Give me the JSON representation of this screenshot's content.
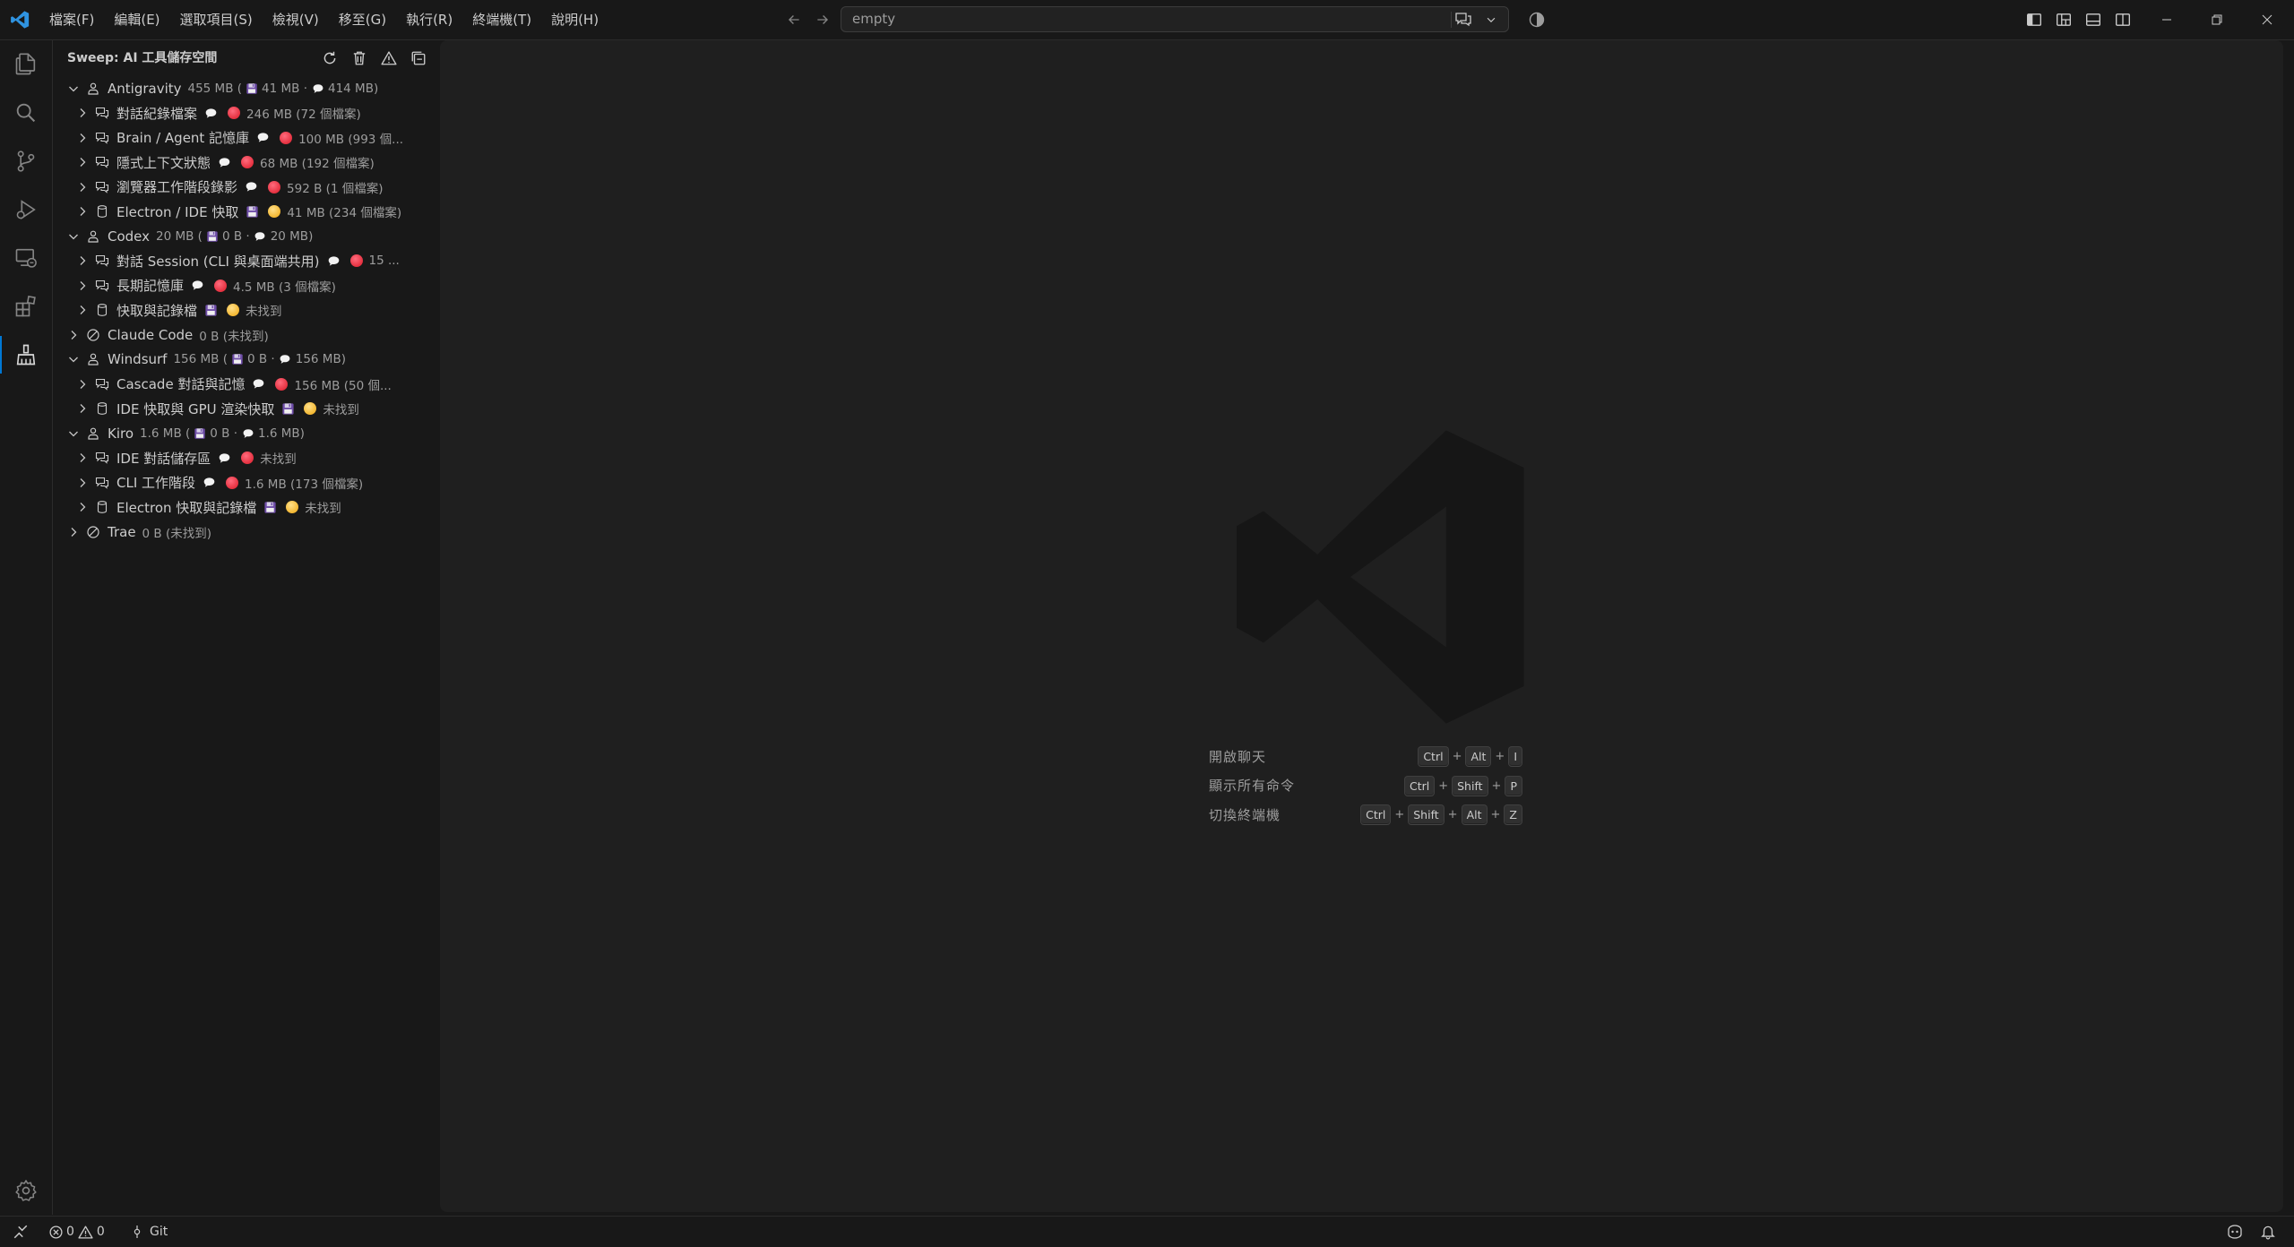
{
  "menubar": {
    "items": [
      "檔案(F)",
      "編輯(E)",
      "選取項目(S)",
      "檢視(V)",
      "移至(G)",
      "執行(R)",
      "終端機(T)",
      "說明(H)"
    ]
  },
  "command_center": {
    "text": "empty"
  },
  "sidebar": {
    "title": "Sweep: AI 工具儲存空間",
    "actions": [
      "refresh-icon",
      "trash-icon",
      "warning-icon",
      "collapse-all-icon"
    ],
    "tree": [
      {
        "kind": "group",
        "expanded": true,
        "label": "Antigravity",
        "size": "455 MB (",
        "mid": "41 MB ·",
        "end": "414 MB)",
        "children": [
          {
            "label": "對話紀錄檔案",
            "type": "chat",
            "status": "red",
            "desc": "246 MB (72 個檔案)"
          },
          {
            "label": "Brain / Agent 記憶庫",
            "type": "chat",
            "status": "red",
            "desc": "100 MB (993 個..."
          },
          {
            "label": "隱式上下文狀態",
            "type": "chat",
            "status": "red",
            "desc": "68 MB (192 個檔案)"
          },
          {
            "label": "瀏覽器工作階段錄影",
            "type": "chat",
            "status": "red",
            "desc": "592 B (1 個檔案)"
          },
          {
            "label": "Electron / IDE 快取",
            "type": "disk",
            "status": "yellow",
            "desc": "41 MB (234 個檔案)"
          }
        ]
      },
      {
        "kind": "group",
        "expanded": true,
        "label": "Codex",
        "size": "20 MB (",
        "mid": "0 B ·",
        "end": "20 MB)",
        "children": [
          {
            "label": "對話 Session (CLI 與桌面端共用)",
            "type": "chat",
            "status": "red",
            "desc": "15 ..."
          },
          {
            "label": "長期記憶庫",
            "type": "chat",
            "status": "red",
            "desc": "4.5 MB (3 個檔案)"
          },
          {
            "label": "快取與記錄檔",
            "type": "disk",
            "status": "yellow",
            "desc": "未找到"
          }
        ]
      },
      {
        "kind": "missing",
        "label": "Claude Code",
        "desc": "0 B (未找到)"
      },
      {
        "kind": "group",
        "expanded": true,
        "label": "Windsurf",
        "size": "156 MB (",
        "mid": "0 B ·",
        "end": "156 MB)",
        "children": [
          {
            "label": "Cascade 對話與記憶",
            "type": "chat",
            "status": "red",
            "desc": "156 MB (50 個..."
          },
          {
            "label": "IDE 快取與 GPU 渲染快取",
            "type": "disk",
            "status": "yellow",
            "desc": "未找到"
          }
        ]
      },
      {
        "kind": "group",
        "expanded": true,
        "label": "Kiro",
        "size": "1.6 MB (",
        "mid": "0 B ·",
        "end": "1.6 MB)",
        "children": [
          {
            "label": "IDE 對話儲存區",
            "type": "chat",
            "status": "red",
            "desc": "未找到"
          },
          {
            "label": "CLI 工作階段",
            "type": "chat",
            "status": "red",
            "desc": "1.6 MB (173 個檔案)"
          },
          {
            "label": "Electron 快取與記錄檔",
            "type": "disk",
            "status": "yellow",
            "desc": "未找到"
          }
        ]
      },
      {
        "kind": "missing",
        "label": "Trae",
        "desc": "0 B (未找到)"
      }
    ]
  },
  "editor": {
    "shortcuts": [
      {
        "label": "開啟聊天",
        "keys": [
          "Ctrl",
          "Alt",
          "I"
        ]
      },
      {
        "label": "顯示所有命令",
        "keys": [
          "Ctrl",
          "Shift",
          "P"
        ]
      },
      {
        "label": "切換終端機",
        "keys": [
          "Ctrl",
          "Shift",
          "Alt",
          "Z"
        ]
      }
    ]
  },
  "statusbar": {
    "errors": "0",
    "warnings": "0",
    "scm": "Git"
  },
  "colors": {
    "accent": "#0078d4",
    "status_red": "#e5303f",
    "status_yellow": "#f2b631"
  }
}
